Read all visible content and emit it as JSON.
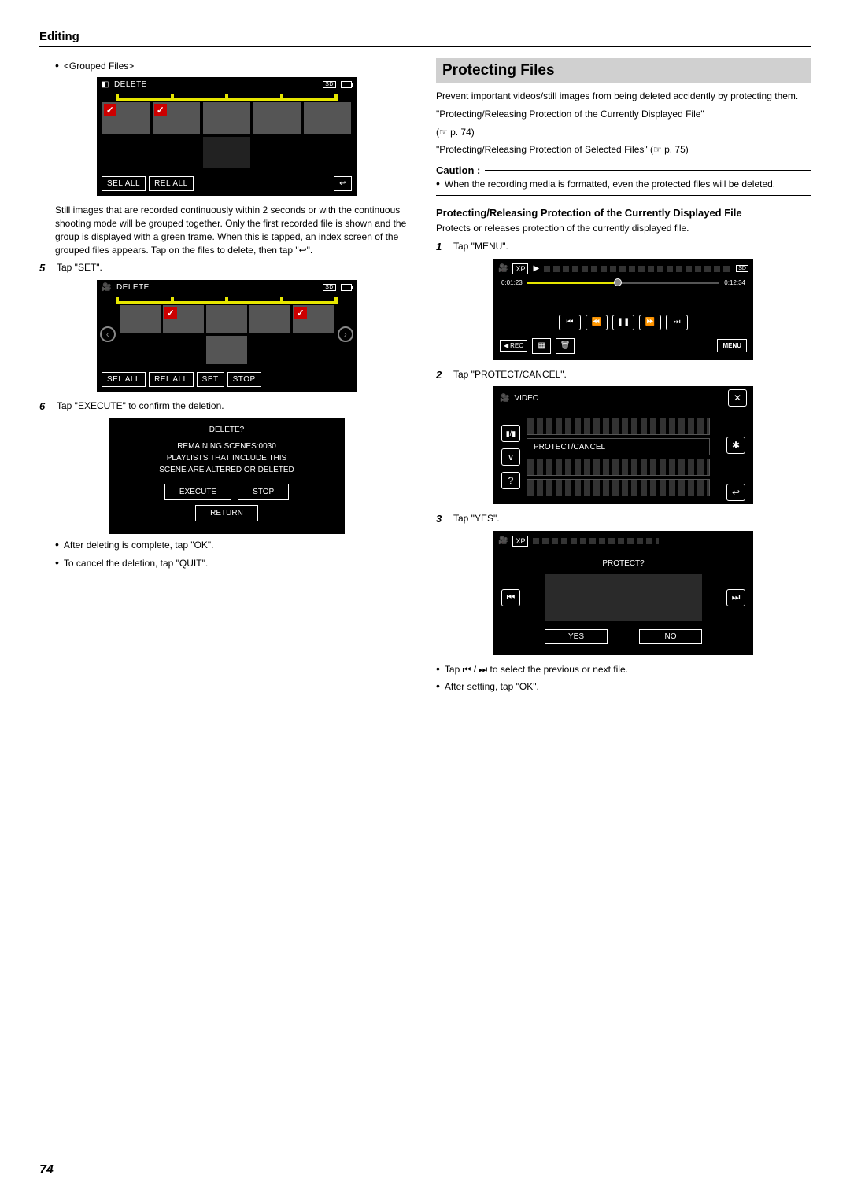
{
  "header": "Editing",
  "page_number": "74",
  "left": {
    "grouped_files_label": "<Grouped Files>",
    "del_screen1": {
      "title": "DELETE",
      "sd": "SD",
      "sel_all": "SEL ALL",
      "rel_all": "REL ALL"
    },
    "grouped_note": "Still images that are recorded continuously within 2 seconds or with the continuous shooting mode will be grouped together. Only the first recorded file is shown and the group is displayed with a green frame. When this is tapped, an index screen of the grouped files appears. Tap on the files to delete, then tap \"↩\".",
    "step5_num": "5",
    "step5_text": "Tap \"SET\".",
    "del_screen2": {
      "title": "DELETE",
      "sd": "SD",
      "sel_all": "SEL ALL",
      "rel_all": "REL ALL",
      "set": "SET",
      "stop": "STOP"
    },
    "step6_num": "6",
    "step6_text": "Tap \"EXECUTE\" to confirm the deletion.",
    "dialog": {
      "title": "DELETE?",
      "body1": "REMAINING SCENES:0030",
      "body2": "PLAYLISTS THAT INCLUDE THIS",
      "body3": "SCENE ARE ALTERED OR DELETED",
      "execute": "EXECUTE",
      "stop": "STOP",
      "return": "RETURN"
    },
    "bullet_ok": "After deleting is complete, tap \"OK\".",
    "bullet_quit": "To cancel the deletion, tap \"QUIT\"."
  },
  "right": {
    "section_title": "Protecting Files",
    "intro": "Prevent important videos/still images from being deleted accidently by protecting them.",
    "link1": "\"Protecting/Releasing Protection of the Currently Displayed File\"",
    "ref1": "(☞ p. 74)",
    "link2": "\"Protecting/Releasing Protection of Selected Files\" (☞ p. 75)",
    "caution_head": "Caution :",
    "caution_bullet": "When the recording media is formatted, even the protected files will be deleted.",
    "sub1": "Protecting/Releasing Protection of the Currently Displayed File",
    "sub1_desc": "Protects or releases protection of the currently displayed file.",
    "step1_num": "1",
    "step1_text": "Tap \"MENU\".",
    "play_screen": {
      "xp": "XP",
      "sd": "SD",
      "t_left": "0:01:23",
      "t_right": "0:12:34",
      "rec": "REC",
      "menu": "MENU"
    },
    "step2_num": "2",
    "step2_text": "Tap \"PROTECT/CANCEL\".",
    "menu_screen": {
      "video": "VIDEO",
      "protect_cancel": "PROTECT/CANCEL"
    },
    "step3_num": "3",
    "step3_text": "Tap \"YES\".",
    "protect_screen": {
      "xp": "XP",
      "q": "PROTECT?",
      "yes": "YES",
      "no": "NO"
    },
    "bullet_prevnext": "Tap ⏮ / ⏭ to select the previous or next file.",
    "bullet_after_ok": "After setting, tap \"OK\"."
  }
}
